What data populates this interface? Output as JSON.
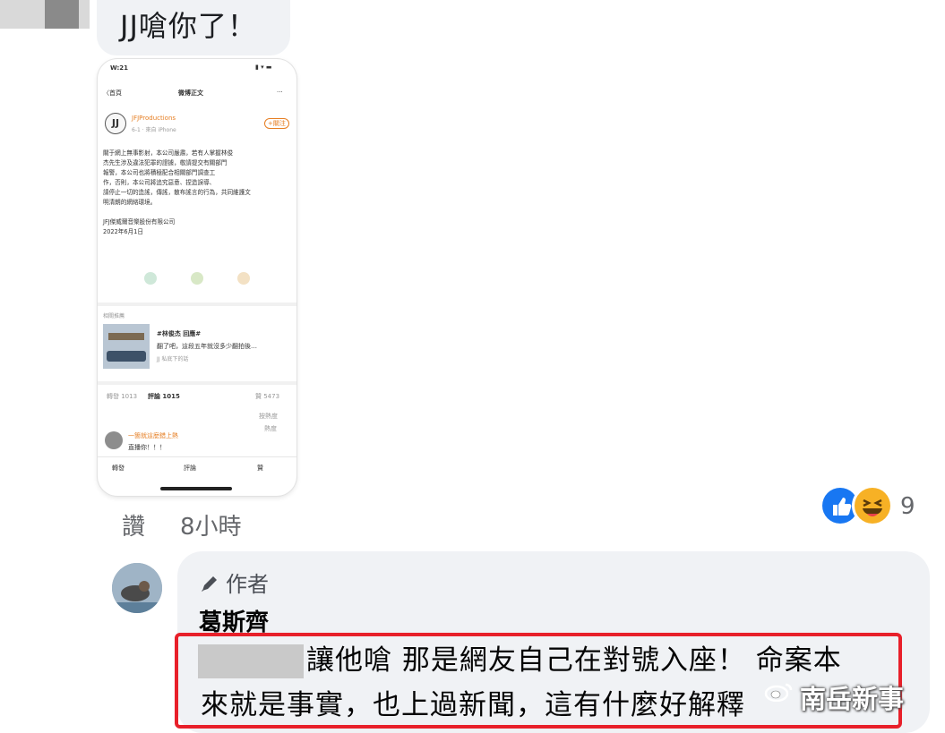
{
  "top_comment": {
    "text": "JJ嗆你了！"
  },
  "phone": {
    "status_time": "W:21",
    "status_right": "▮ ▾ ▬",
    "nav_back": "〈首頁",
    "nav_title": "微博正文",
    "nav_more": "···",
    "account": "JFJProductions",
    "account_sub": "6-1 · 來自 iPhone",
    "follow": "+關注",
    "body_lines": [
      "關于網上無事影射，本公司嚴肅，若有人掌握林俊",
      "杰先生涉及違法犯罪的證據，敬請提交有關部門",
      "報警，本公司也將積極配合相關部門調查工",
      "作，否則，本公司將追究惡意、捏造誤導、",
      "請停止一切的造謠，傳謠，散布謠言的行為，共同維護文",
      "明清朗的網絡環境。"
    ],
    "signature": "JFJ傑威爾音樂股份有限公司",
    "date": "2022年6月1日",
    "section_label": "相關推薦",
    "card_title": "#林俊杰 回應#",
    "card_desc": "翻了吧，這段五年就沒多少翻拍後…",
    "card_meta": "JJ 私底下的話",
    "tab_repost": "轉發 1013",
    "tab_comment": "評論 1015",
    "tab_like": "贊 5473",
    "sort": "按熱度",
    "hot": "熱度",
    "commenter": "一箇就這麼錯上熱",
    "comment_text": "直播你！！！",
    "btn_repost": "轉發",
    "btn_comment": "評論",
    "btn_like": "贊"
  },
  "meta": {
    "like": "讚",
    "time": "8小時"
  },
  "reactions": {
    "count": "9"
  },
  "reply": {
    "author_badge": "作者",
    "author_name": "葛斯齊",
    "text_line1": "讓他嗆 那是網友自己在對號入座！ 命案本",
    "text_line2": "來就是事實，也上過新聞，這有什麼好解釋"
  },
  "watermark": {
    "text": "南岳新事"
  },
  "colors": {
    "highlight": "#e8202a",
    "like_blue": "#1877f2",
    "haha_yellow": "#f7b125",
    "bubble_bg": "#f0f2f5"
  }
}
